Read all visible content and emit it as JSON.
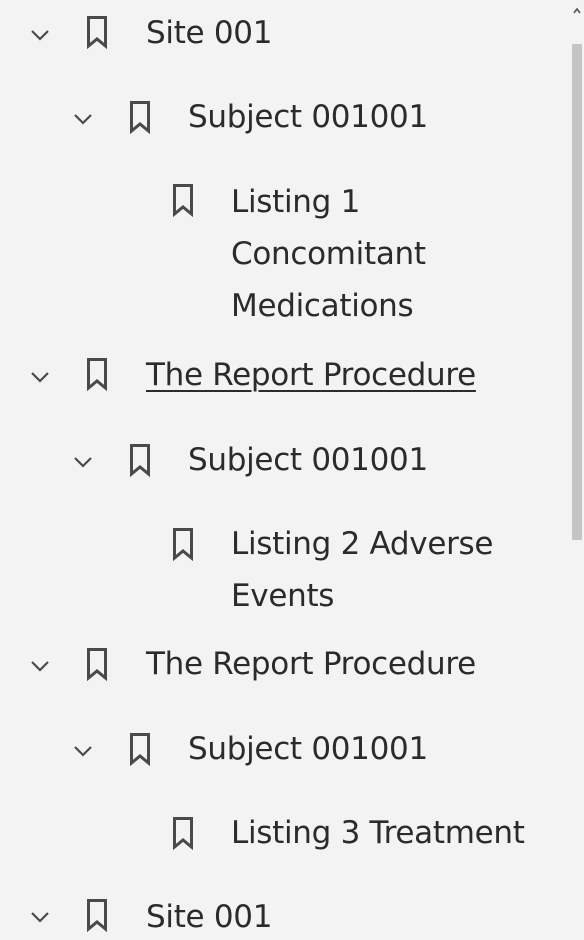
{
  "bookmarks": {
    "items": [
      {
        "label": "Site 001",
        "expanded": true,
        "icon": "bookmark-icon"
      },
      {
        "label": "Subject 001001",
        "expanded": true,
        "icon": "bookmark-icon"
      },
      {
        "label": "Listing 1 Concomitant Medications",
        "icon": "bookmark-icon"
      },
      {
        "label": "The Report Procedure",
        "expanded": true,
        "icon": "bookmark-icon",
        "hovered": true
      },
      {
        "label": "Subject 001001",
        "expanded": true,
        "icon": "bookmark-icon"
      },
      {
        "label": "Listing 2 Adverse Events",
        "icon": "bookmark-icon"
      },
      {
        "label": "The Report Procedure",
        "expanded": true,
        "icon": "bookmark-icon"
      },
      {
        "label": "Subject 001001",
        "expanded": true,
        "icon": "bookmark-icon"
      },
      {
        "label": "Listing 3 Treatment",
        "icon": "bookmark-icon"
      },
      {
        "label": "Site 001",
        "expanded": true,
        "icon": "bookmark-icon"
      }
    ]
  },
  "colors": {
    "background": "#f3f3f3",
    "text": "#2b2b2b",
    "icon": "#4a4a4a",
    "scroll_thumb": "#c4c4c4"
  }
}
